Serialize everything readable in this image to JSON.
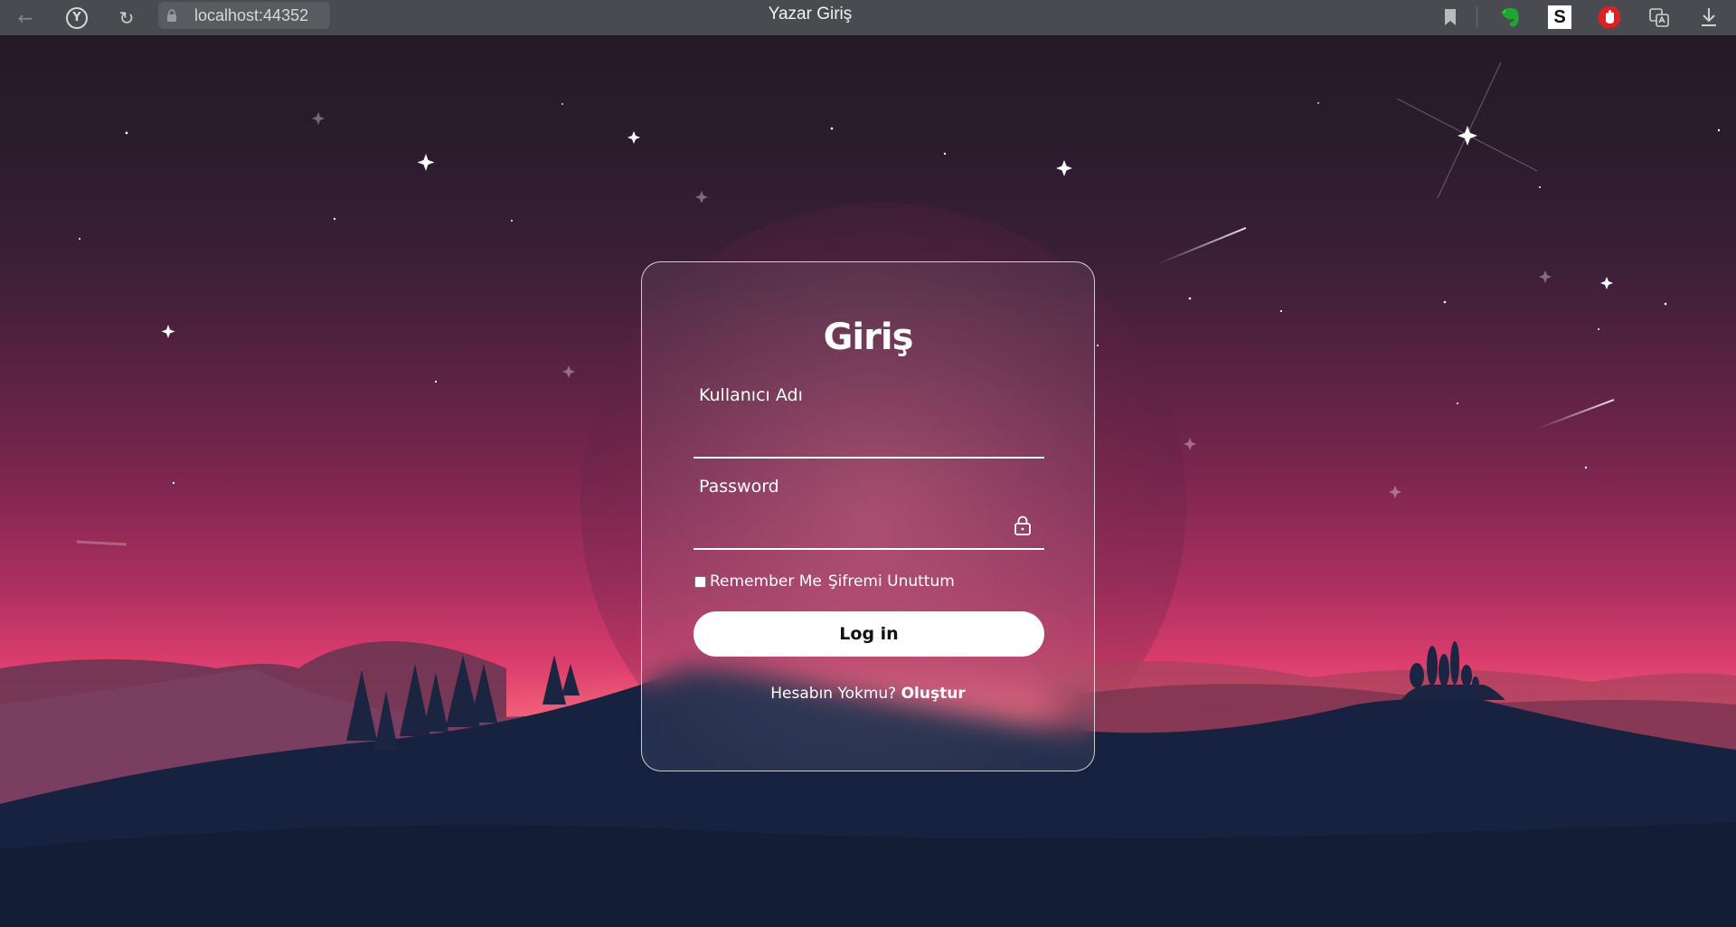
{
  "browser": {
    "url": "localhost:44352",
    "tab_title": "Yazar Giriş",
    "nav": {
      "back": "←",
      "home_logo": "Y",
      "reload": "↻"
    },
    "extensions": [
      "bookmark-icon",
      "evernote-icon",
      "s-extension-icon",
      "adblock-icon",
      "translate-icon",
      "download-icon"
    ],
    "extension_letter": "S"
  },
  "login": {
    "title": "Giriş",
    "username_label": "Kullanıcı Adı",
    "username_value": "",
    "password_label": "Password",
    "password_value": "",
    "remember_label": "Remember Me",
    "remember_checked": false,
    "forgot_label": "Şifremi Unuttum",
    "submit_label": "Log in",
    "no_account_text": "Hesabın Yokmu?",
    "register_label": "Oluştur"
  },
  "colors": {
    "chrome_bg": "#4a4b50",
    "card_border": "#ffffff",
    "button_bg": "#ffffff",
    "sky_top": "#231a26",
    "sky_horizon": "#ef5a76",
    "ground": "#131d33"
  }
}
